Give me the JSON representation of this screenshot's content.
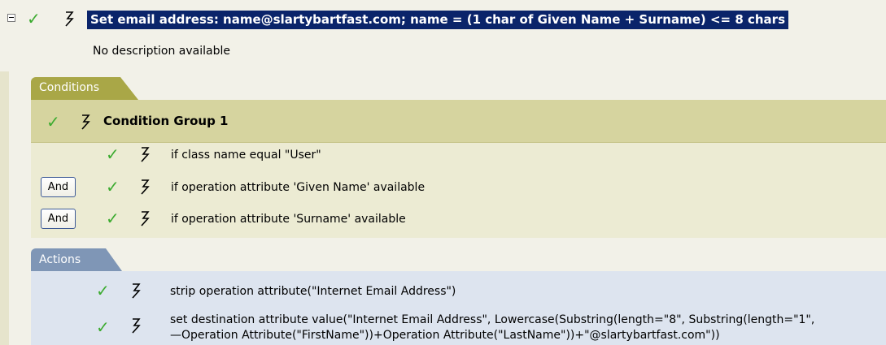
{
  "rule": {
    "title": "Set email address: name@slartybartfast.com; name = (1 char of Given Name + Surname) <= 8 chars",
    "description": "No description available"
  },
  "conditions": {
    "tab_label": "Conditions",
    "group_label": "Condition Group 1",
    "items": [
      {
        "connector": "",
        "text": "if class name equal \"User\""
      },
      {
        "connector": "And",
        "text": "if operation attribute 'Given Name' available"
      },
      {
        "connector": "And",
        "text": "if operation attribute 'Surname' available"
      }
    ]
  },
  "actions": {
    "tab_label": "Actions",
    "items": [
      {
        "text": "strip operation attribute(\"Internet Email Address\")"
      },
      {
        "text": "set destination attribute value(\"Internet Email Address\", Lowercase(Substring(length=\"8\", Substring(length=\"1\",",
        "continuation": "—Operation Attribute(\"FirstName\"))+Operation Attribute(\"LastName\"))+\"@slartybartfast.com\"))"
      }
    ]
  },
  "icons": {
    "collapse": "collapse-icon",
    "check": "check-icon",
    "bolt": "bolt-icon"
  },
  "colors": {
    "selection": "#0a246a",
    "check": "#3cab30",
    "conditions_tab": "#a9a747",
    "conditions_group": "#d6d49f",
    "actions_tab": "#7f96b6",
    "actions_panel": "#dde4ef"
  }
}
